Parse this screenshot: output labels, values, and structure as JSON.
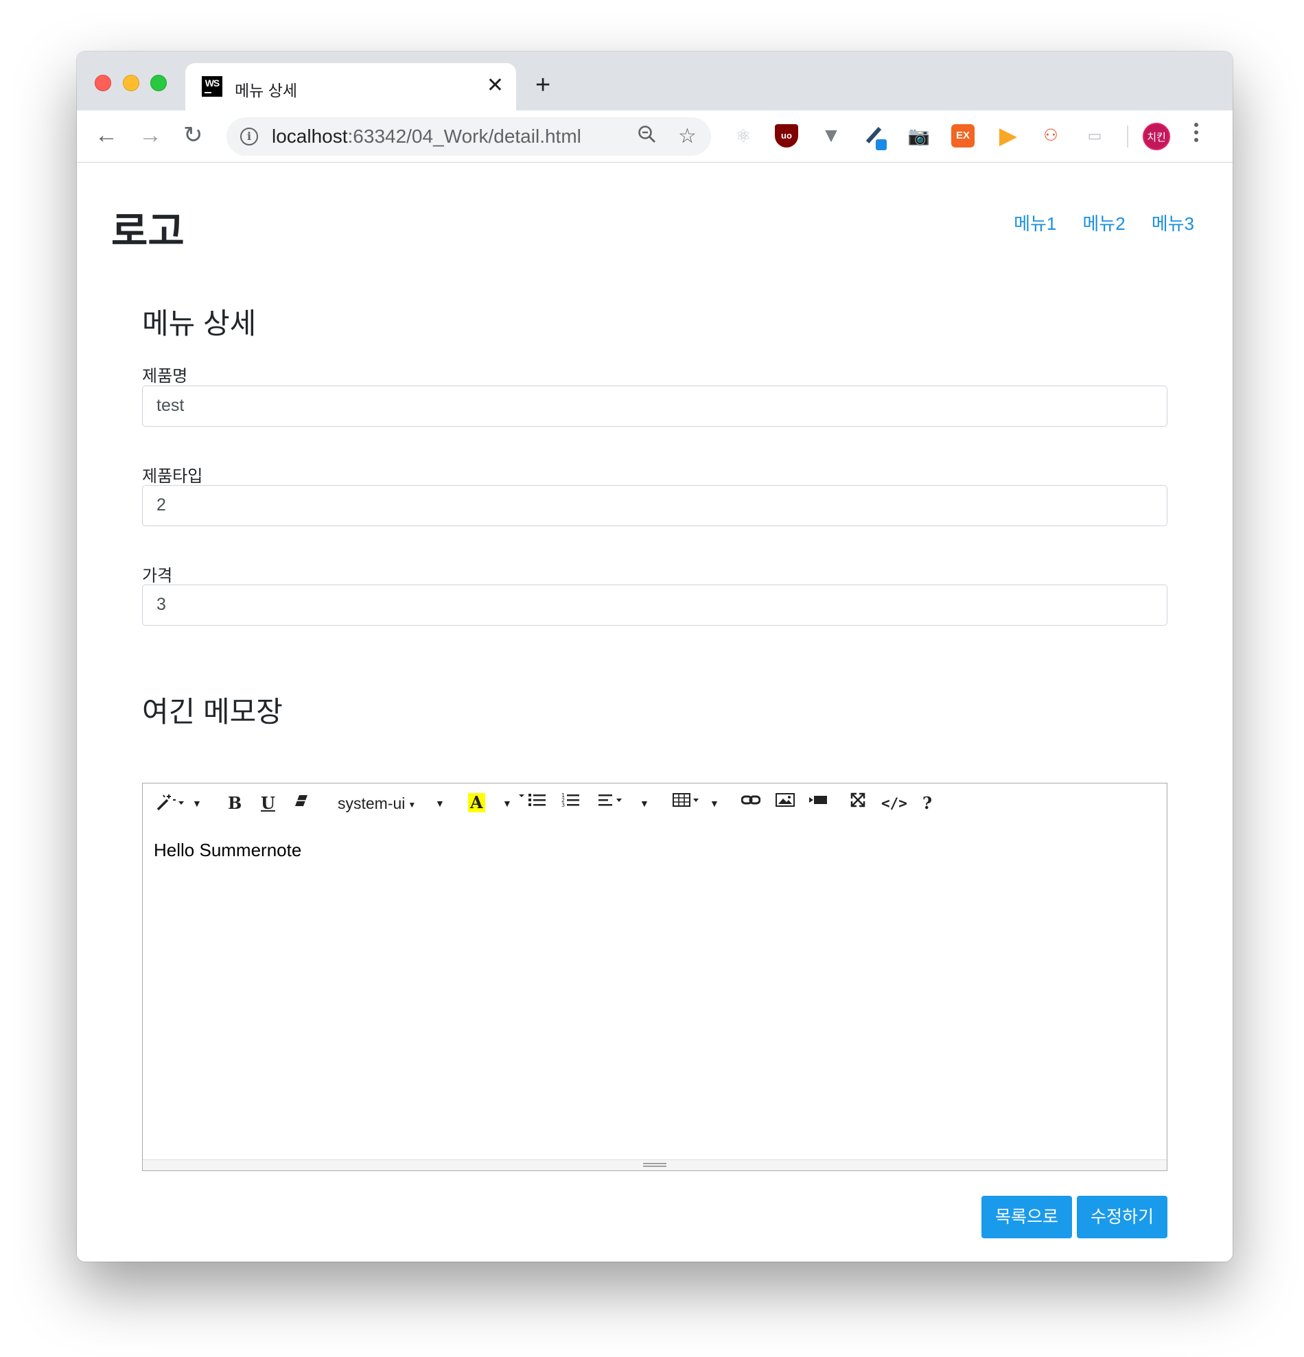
{
  "browser": {
    "tab_title": "메뉴 상세",
    "tab_favicon_text": "WS",
    "url_host": "localhost",
    "url_path": ":63342/04_Work/detail.html",
    "profile_label": "치킨",
    "ext_ex_label": "EX"
  },
  "header": {
    "logo": "로고",
    "nav": [
      "메뉴1",
      "메뉴2",
      "메뉴3"
    ]
  },
  "detail": {
    "title": "메뉴 상세",
    "fields": [
      {
        "label": "제품명",
        "value": "test"
      },
      {
        "label": "제품타입",
        "value": "2"
      },
      {
        "label": "가격",
        "value": "3"
      }
    ]
  },
  "memo": {
    "title": "여긴 메모장",
    "font_name": "system-ui",
    "content": "Hello Summernote"
  },
  "actions": {
    "list_label": "목록으로",
    "edit_label": "수정하기"
  },
  "colors": {
    "accent": "#1a9aea",
    "link": "#1a8fdd"
  }
}
